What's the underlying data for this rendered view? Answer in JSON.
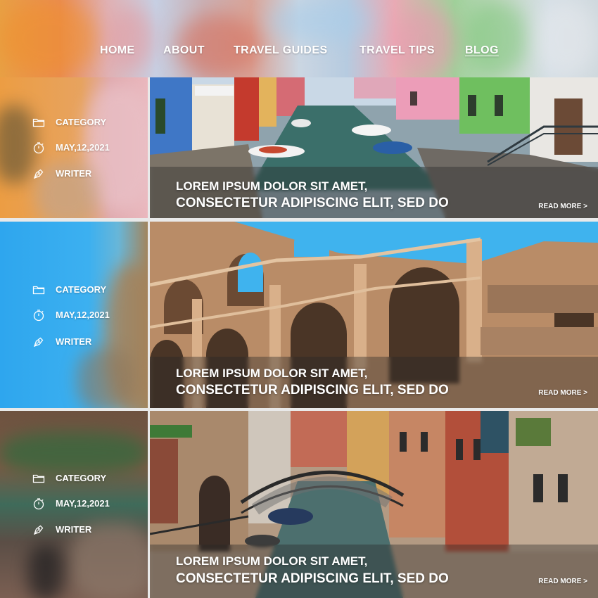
{
  "nav": {
    "items": [
      {
        "label": "HOME",
        "active": false
      },
      {
        "label": "ABOUT",
        "active": false
      },
      {
        "label": "TRAVEL GUIDES",
        "active": false
      },
      {
        "label": "TRAVEL TIPS",
        "active": false
      },
      {
        "label": "BLOG",
        "active": true
      }
    ]
  },
  "posts": [
    {
      "meta": {
        "category": "CATEGORY",
        "date": "MAY,12,2021",
        "writer": "WRITER"
      },
      "title_line1": "LOREM IPSUM DOLOR SIT AMET,",
      "title_line2": "CONSECTETUR ADIPISCING ELIT, SED DO",
      "read_more": "READ MORE >",
      "scene": "colorful-canal-houses"
    },
    {
      "meta": {
        "category": "CATEGORY",
        "date": "MAY,12,2021",
        "writer": "WRITER"
      },
      "title_line1": "LOREM IPSUM DOLOR SIT AMET,",
      "title_line2": "CONSECTETUR ADIPISCING ELIT, SED DO",
      "read_more": "READ MORE >",
      "scene": "colosseum-arches"
    },
    {
      "meta": {
        "category": "CATEGORY",
        "date": "MAY,12,2021",
        "writer": "WRITER"
      },
      "title_line1": "LOREM IPSUM DOLOR SIT AMET,",
      "title_line2": "CONSECTETUR ADIPISCING ELIT, SED DO",
      "read_more": "READ MORE >",
      "scene": "venice-canal-bridge"
    }
  ],
  "icons": {
    "category": "folder-icon",
    "date": "stopwatch-icon",
    "writer": "pen-nib-icon"
  }
}
